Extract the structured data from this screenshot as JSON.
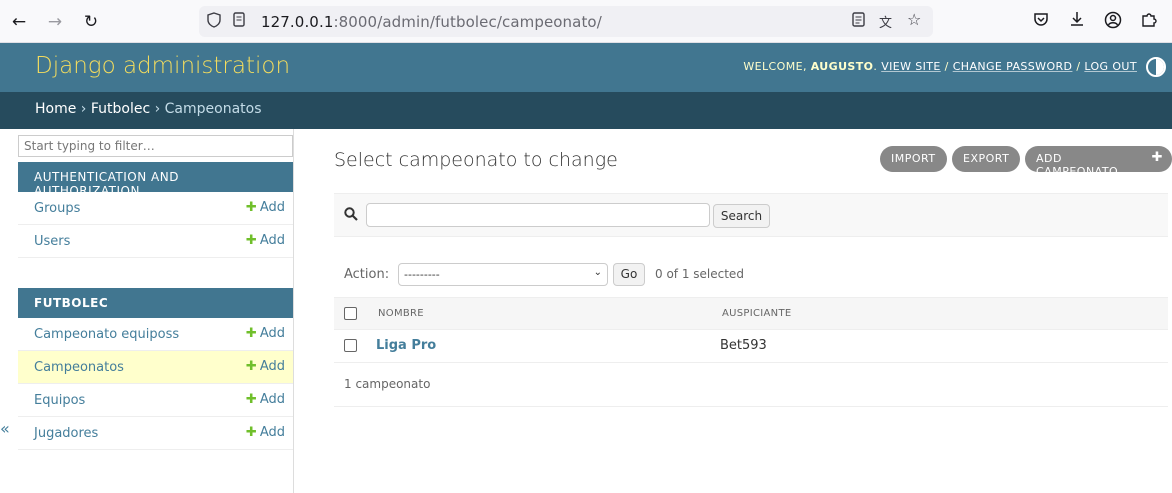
{
  "browser": {
    "url_host": "127.0.0.1",
    "url_rest": ":8000/admin/futbolec/campeonato/"
  },
  "header": {
    "brand": "Django administration",
    "welcome": "WELCOME, ",
    "username": "AUGUSTO",
    "view_site": "VIEW SITE",
    "change_password": "CHANGE PASSWORD",
    "log_out": "LOG OUT"
  },
  "breadcrumbs": {
    "home": "Home",
    "app": "Futbolec",
    "current": "Campeonatos"
  },
  "sidebar": {
    "filter_placeholder": "Start typing to filter…",
    "modules": [
      {
        "caption": "Authentication and Authorization",
        "models": [
          {
            "name": "Groups",
            "add": "Add"
          },
          {
            "name": "Users",
            "add": "Add"
          }
        ]
      },
      {
        "caption": "Futbolec",
        "models": [
          {
            "name": "Campeonato equiposs",
            "add": "Add"
          },
          {
            "name": "Campeonatos",
            "add": "Add",
            "current": true
          },
          {
            "name": "Equipos",
            "add": "Add"
          },
          {
            "name": "Jugadores",
            "add": "Add"
          }
        ]
      }
    ],
    "collapse": "«"
  },
  "content": {
    "title": "Select campeonato to change",
    "tools": {
      "import": "Import",
      "export": "Export",
      "add": "Add campeonato"
    },
    "search": {
      "value": "",
      "button": "Search"
    },
    "actions": {
      "label": "Action:",
      "selected_option": "---------",
      "go": "Go",
      "counter": "0 of 1 selected"
    },
    "table": {
      "columns": [
        "Nombre",
        "Auspiciante"
      ],
      "rows": [
        {
          "nombre": "Liga Pro",
          "auspiciante": "Bet593"
        }
      ]
    },
    "paginator": "1 campeonato"
  },
  "colors": {
    "header": "#417690",
    "breadcrumbs": "#264b5d",
    "brand": "#f5dd5d",
    "link": "#447e9b",
    "add_plus": "#70bf2b",
    "current_row": "#ffffcc"
  }
}
